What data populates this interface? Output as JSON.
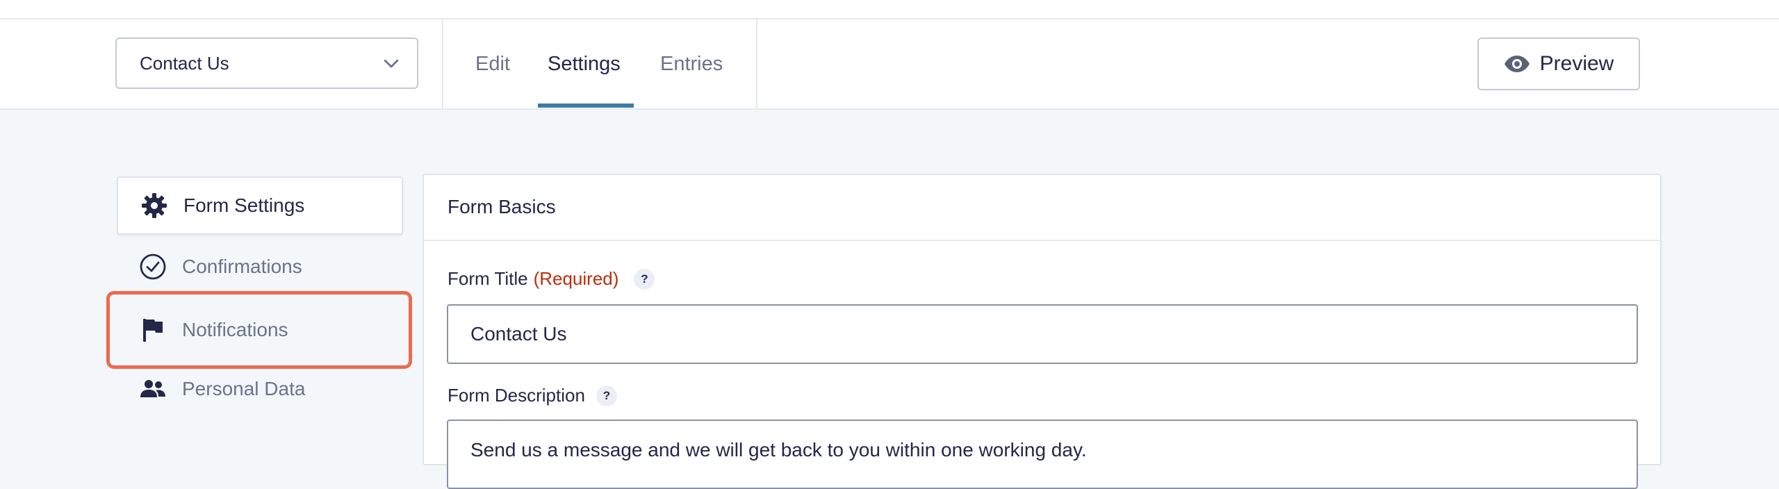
{
  "header": {
    "form_selector": {
      "value": "Contact Us"
    },
    "tabs": [
      {
        "label": "Edit"
      },
      {
        "label": "Settings",
        "active": true
      },
      {
        "label": "Entries"
      }
    ],
    "preview_label": "Preview"
  },
  "sidebar": {
    "items": [
      {
        "label": "Form Settings",
        "icon": "gear-icon",
        "active": true
      },
      {
        "label": "Confirmations",
        "icon": "check-circle-icon"
      },
      {
        "label": "Notifications",
        "icon": "flag-icon",
        "highlighted": true
      },
      {
        "label": "Personal Data",
        "icon": "users-icon"
      }
    ]
  },
  "panel": {
    "title": "Form Basics",
    "form_title": {
      "label": "Form Title",
      "required": "(Required)",
      "help": "?",
      "value": "Contact Us"
    },
    "form_description": {
      "label": "Form Description",
      "help": "?",
      "value": "Send us a message and we will get back to you within one working day."
    }
  },
  "colors": {
    "accent": "#3e7da6",
    "required": "#c02b0a",
    "highlight": "#ec6a4f",
    "text": "#242748",
    "muted": "#6b7389",
    "page_bg": "#f4f7fa"
  }
}
